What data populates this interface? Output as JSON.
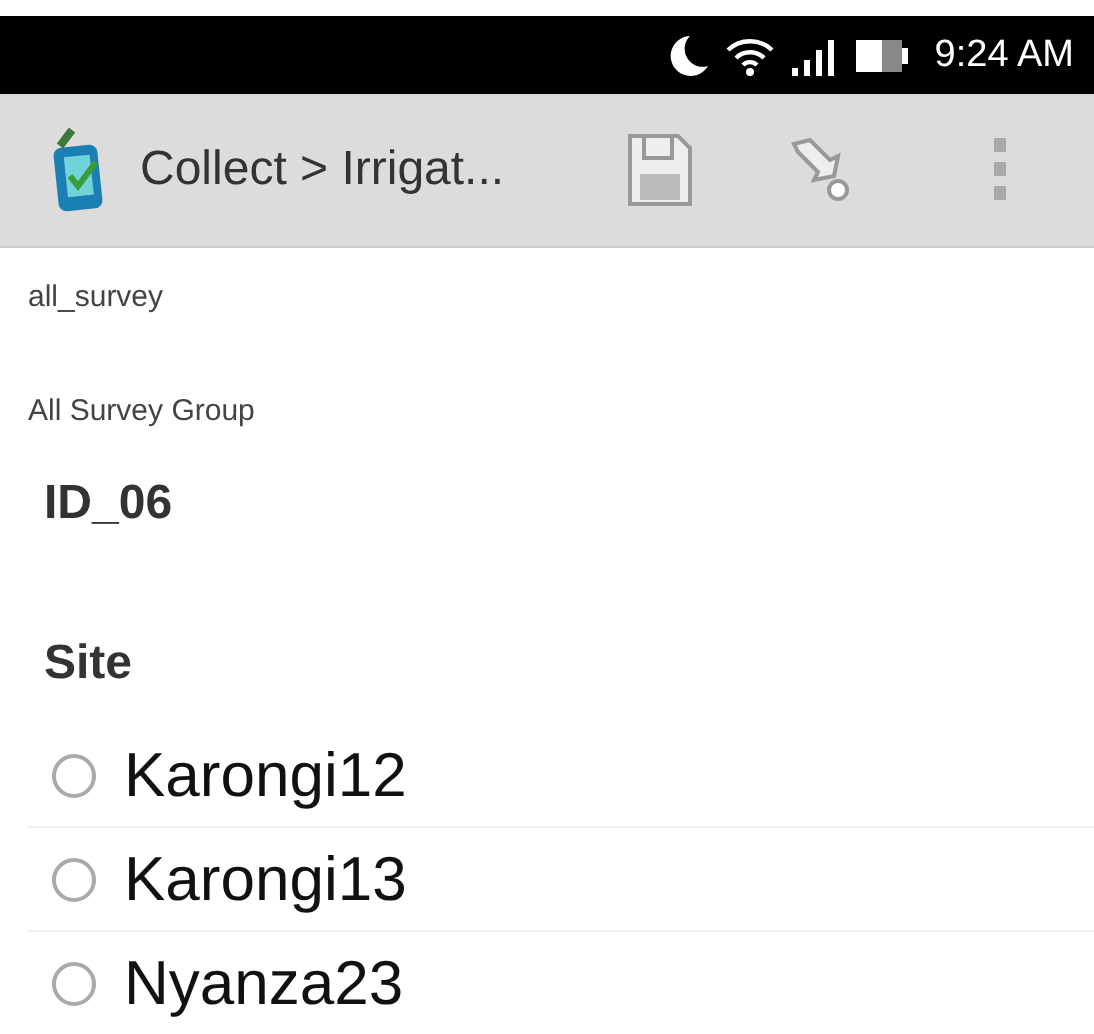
{
  "status_bar": {
    "time": "9:24 AM"
  },
  "toolbar": {
    "title": "Collect > Irrigat..."
  },
  "form": {
    "name": "all_survey",
    "group": "All Survey Group",
    "id": "ID_06",
    "question": "Site",
    "options": [
      {
        "label": "Karongi12",
        "selected": false
      },
      {
        "label": "Karongi13",
        "selected": false
      },
      {
        "label": "Nyanza23",
        "selected": false
      }
    ]
  }
}
